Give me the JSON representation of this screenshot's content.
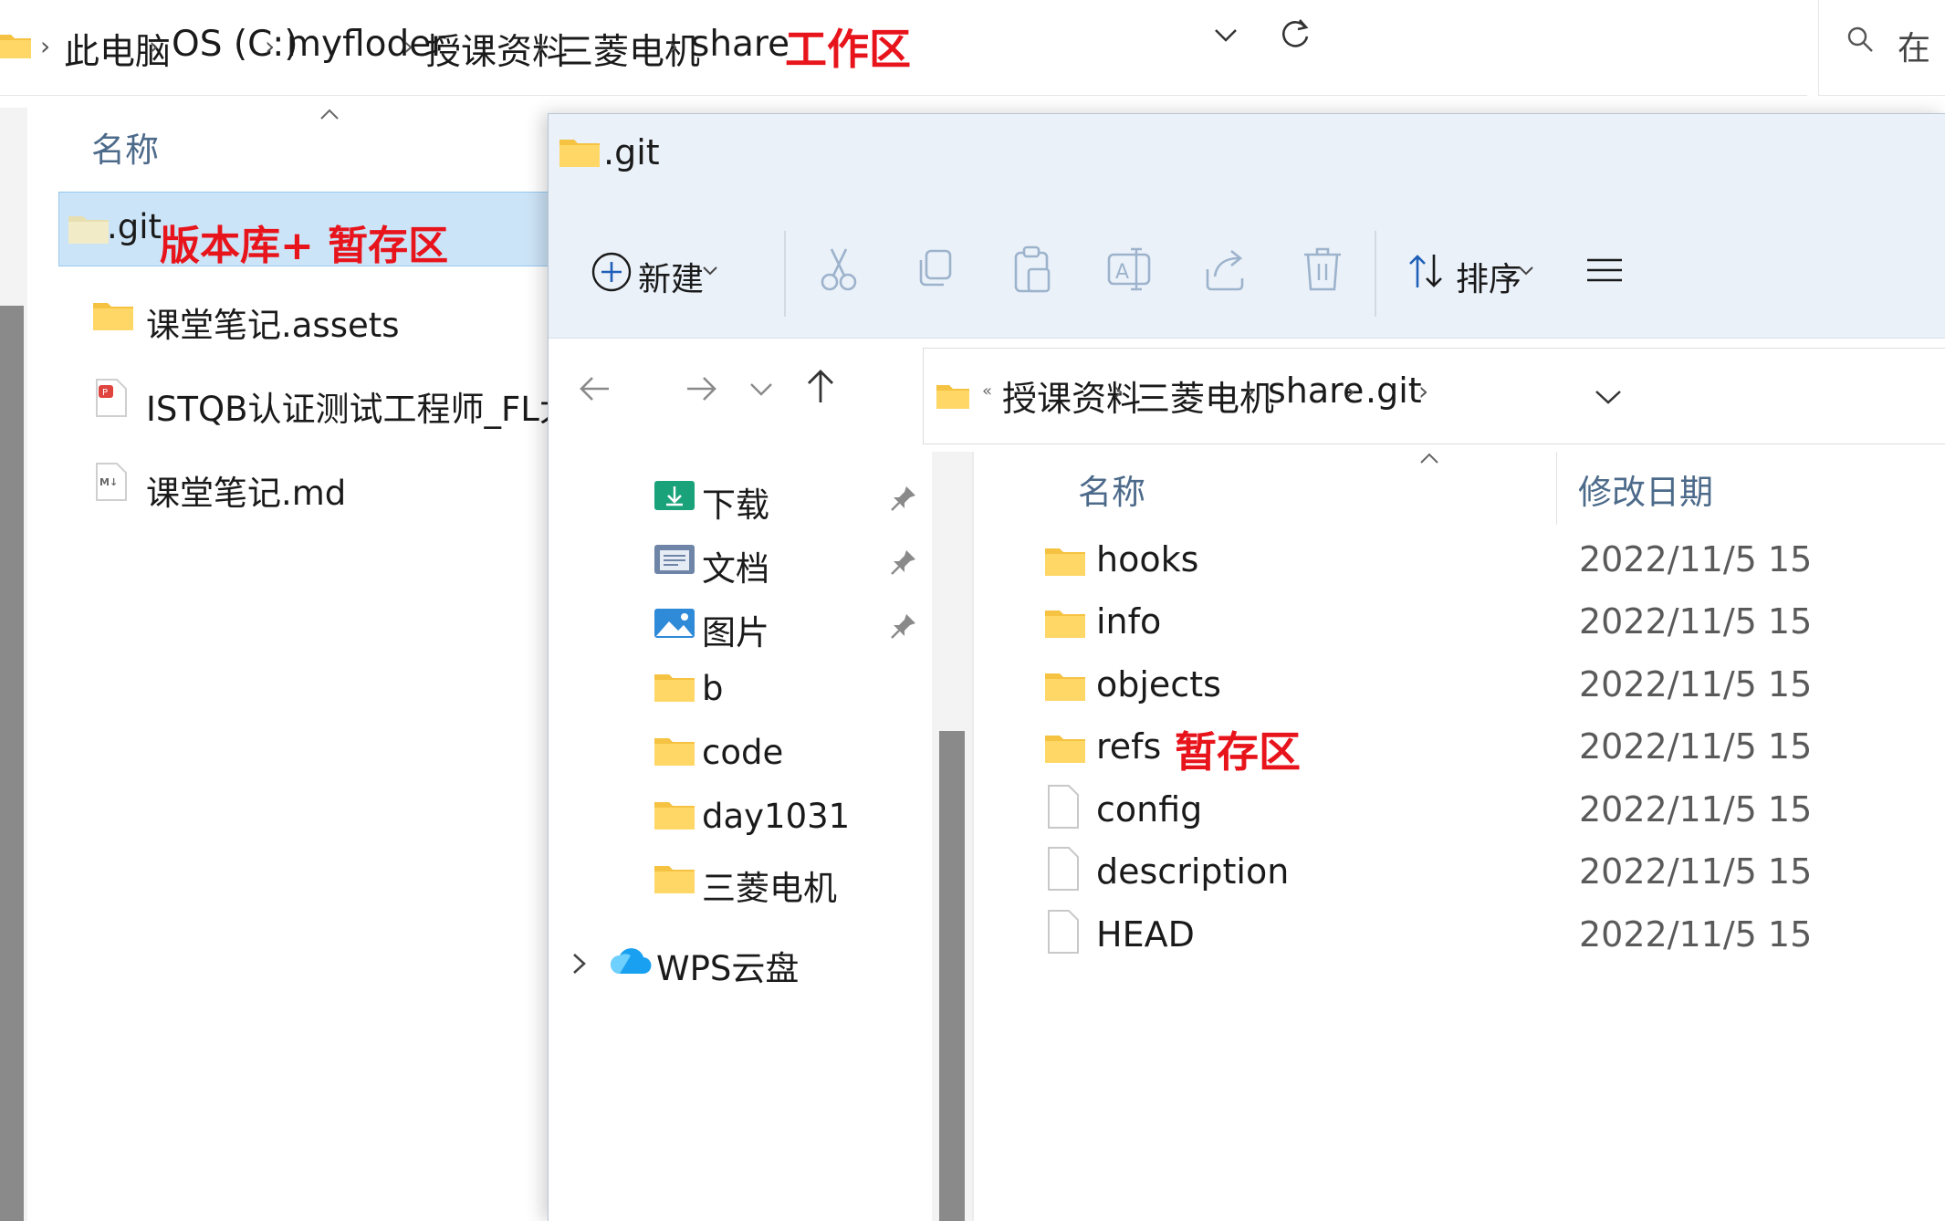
{
  "back_window": {
    "breadcrumbs": [
      "此电脑",
      "OS (C:)",
      "myfloder",
      "授课资料",
      "三菱电机",
      "share"
    ],
    "annotation_workspace": "工作区",
    "search_placeholder": "在",
    "column_name": "名称",
    "files": [
      {
        "name": ".git",
        "type": "folder",
        "selected": true
      },
      {
        "name": "课堂笔记.assets",
        "type": "folder"
      },
      {
        "name": "ISTQB认证测试工程师_FL大",
        "type": "pdf"
      },
      {
        "name": "课堂笔记.md",
        "type": "markdown"
      }
    ],
    "annotation_repo": "版本库+ 暂存区"
  },
  "front_window": {
    "title": ".git",
    "toolbar": {
      "new_label": "新建",
      "sort_label": "排序",
      "actions": [
        "cut-icon",
        "copy-icon",
        "paste-icon",
        "rename-icon",
        "share-icon",
        "delete-icon"
      ]
    },
    "breadcrumbs": [
      "授课资料",
      "三菱电机",
      "share",
      ".git"
    ],
    "sidebar": {
      "items": [
        {
          "label": "下载",
          "icon": "downloads-icon",
          "pinned": true
        },
        {
          "label": "文档",
          "icon": "documents-icon",
          "pinned": true
        },
        {
          "label": "图片",
          "icon": "pictures-icon",
          "pinned": true
        },
        {
          "label": "b",
          "icon": "folder-icon"
        },
        {
          "label": "code",
          "icon": "folder-icon"
        },
        {
          "label": "day1031",
          "icon": "folder-icon"
        },
        {
          "label": "三菱电机",
          "icon": "folder-icon"
        }
      ],
      "cloud_label": "WPS云盘"
    },
    "columns": {
      "name": "名称",
      "modified": "修改日期"
    },
    "files": [
      {
        "name": "hooks",
        "type": "folder",
        "date": "2022/11/5 15"
      },
      {
        "name": "info",
        "type": "folder",
        "date": "2022/11/5 15"
      },
      {
        "name": "objects",
        "type": "folder",
        "date": "2022/11/5 15"
      },
      {
        "name": "refs",
        "type": "folder",
        "date": "2022/11/5 15"
      },
      {
        "name": "config",
        "type": "file",
        "date": "2022/11/5 15"
      },
      {
        "name": "description",
        "type": "file",
        "date": "2022/11/5 15"
      },
      {
        "name": "HEAD",
        "type": "file",
        "date": "2022/11/5 15"
      }
    ],
    "annotation_staging": "暂存区"
  },
  "colors": {
    "annotation": "#e8141c",
    "folder": "#f7c948",
    "selection": "#cce4f7",
    "ribbon": "#eaf1f9"
  }
}
